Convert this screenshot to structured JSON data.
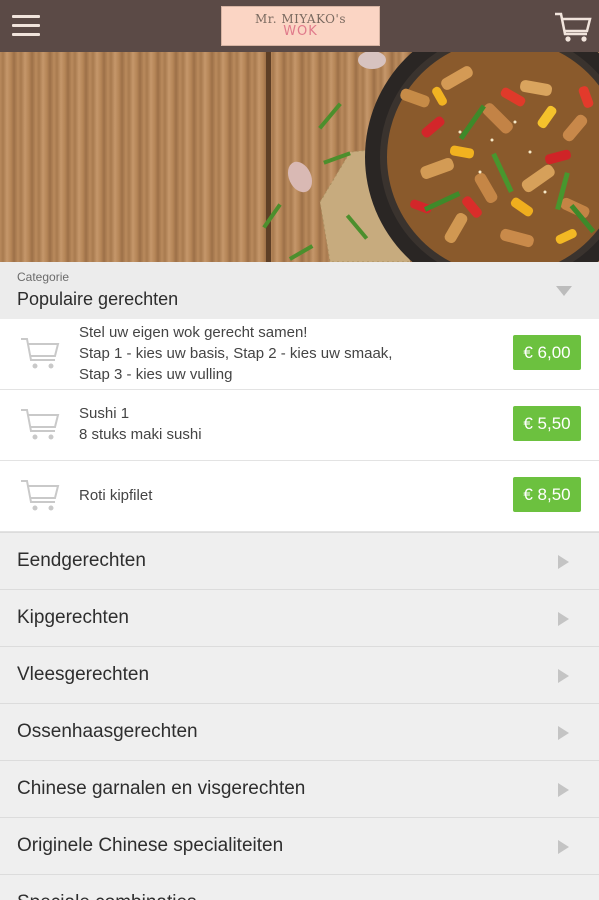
{
  "header": {
    "logo_line1": "Mr. MIYAKO's",
    "logo_line2": "WOK",
    "cart_count": "0"
  },
  "category_selector": {
    "label": "Categorie",
    "value": "Populaire gerechten"
  },
  "products": [
    {
      "line1": "Stel uw eigen wok gerecht samen!",
      "line2": "Stap 1 - kies uw basis, Stap 2 - kies uw smaak,",
      "line3": "Stap 3 - kies uw vulling",
      "price": "€ 6,00"
    },
    {
      "line1": "Sushi 1",
      "line2": "8 stuks maki sushi",
      "price": "€ 5,50"
    },
    {
      "line1": "Roti kipfilet",
      "price": "€ 8,50"
    }
  ],
  "categories": [
    "Eendgerechten",
    "Kipgerechten",
    "Vleesgerechten",
    "Ossenhaasgerechten",
    "Chinese garnalen en visgerechten",
    "Originele Chinese specialiteiten",
    "Speciale combinaties"
  ],
  "colors": {
    "topbar": "#5b4a46",
    "price_button": "#6cc13f",
    "logo_bg": "#fbd5c4"
  }
}
